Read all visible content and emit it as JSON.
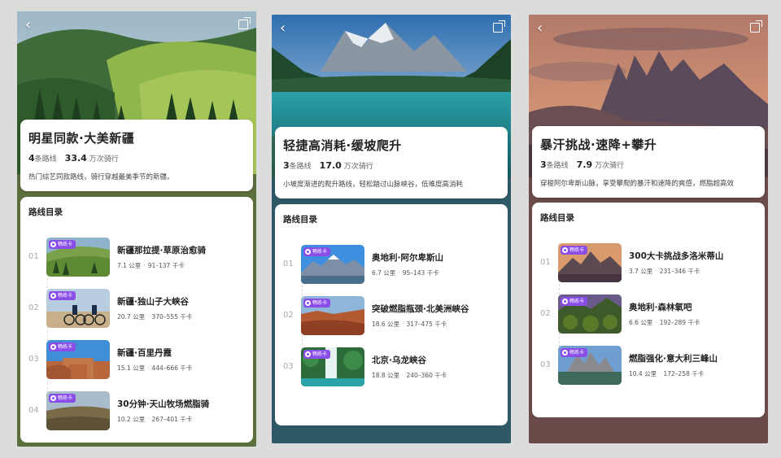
{
  "screens": [
    {
      "title": "明星同款·大美新疆",
      "route_count": "4",
      "route_unit": "条路线",
      "rides": "33.4",
      "rides_unit": "万次骑行",
      "description": "热门综艺同款路线，骑行穿越最美季节的新疆。",
      "catalog_title": "路线目录",
      "routes": [
        {
          "index": "01",
          "badge": "畅练卡",
          "name": "新疆那拉提·草原治愈骑",
          "distance": "7.1 公里",
          "calories": "91–137 千卡"
        },
        {
          "index": "02",
          "badge": "畅练卡",
          "name": "新疆·独山子大峡谷",
          "distance": "20.7 公里",
          "calories": "370–555 千卡"
        },
        {
          "index": "03",
          "badge": "畅练卡",
          "name": "新疆·百里丹霞",
          "distance": "15.1 公里",
          "calories": "444–666 千卡"
        },
        {
          "index": "04",
          "badge": "畅练卡",
          "name": "30分钟·天山牧场燃脂骑",
          "distance": "10.2 公里",
          "calories": "267–401 千卡"
        }
      ]
    },
    {
      "title": "轻捷高消耗·缓坡爬升",
      "route_count": "3",
      "route_unit": "条路线",
      "rides": "17.0",
      "rides_unit": "万次骑行",
      "description": "小坡度渐进的爬升路线，轻松踏过山脉峡谷，低难度高消耗",
      "catalog_title": "路线目录",
      "routes": [
        {
          "index": "01",
          "badge": "畅练卡",
          "name": "奥地利·阿尔卑斯山",
          "distance": "6.7 公里",
          "calories": "95–143 千卡"
        },
        {
          "index": "02",
          "badge": "畅练卡",
          "name": "突破燃脂瓶颈·北美洲峡谷",
          "distance": "18.6 公里",
          "calories": "317–475 千卡"
        },
        {
          "index": "03",
          "badge": "畅练卡",
          "name": "北京·乌龙峡谷",
          "distance": "18.8 公里",
          "calories": "240–360 千卡"
        }
      ]
    },
    {
      "title": "暴汗挑战·速降+攀升",
      "route_count": "3",
      "route_unit": "条路线",
      "rides": "7.9",
      "rides_unit": "万次骑行",
      "description": "穿梭阿尔卑斯山脉，享受攀爬的暴汗和速降的爽感，燃脂超高效",
      "catalog_title": "路线目录",
      "routes": [
        {
          "index": "01",
          "badge": "畅练卡",
          "name": "300大卡挑战多洛米蒂山",
          "distance": "3.7 公里",
          "calories": "231–346 千卡"
        },
        {
          "index": "02",
          "badge": "畅练卡",
          "name": "奥地利·森林氧吧",
          "distance": "6.6 公里",
          "calories": "192–289 千卡"
        },
        {
          "index": "03",
          "badge": "畅练卡",
          "name": "燃脂强化·意大利三峰山",
          "distance": "10.4 公里",
          "calories": "172–258 千卡"
        }
      ]
    }
  ],
  "icons": {
    "back": "chevron-left-icon",
    "share": "share-icon",
    "badge": "card-badge-icon"
  },
  "colors": {
    "screen1_bg": "#5b6e3e",
    "screen2_bg": "#2f5866",
    "screen3_bg": "#6b4a4a",
    "badge": "#8a4de8"
  }
}
